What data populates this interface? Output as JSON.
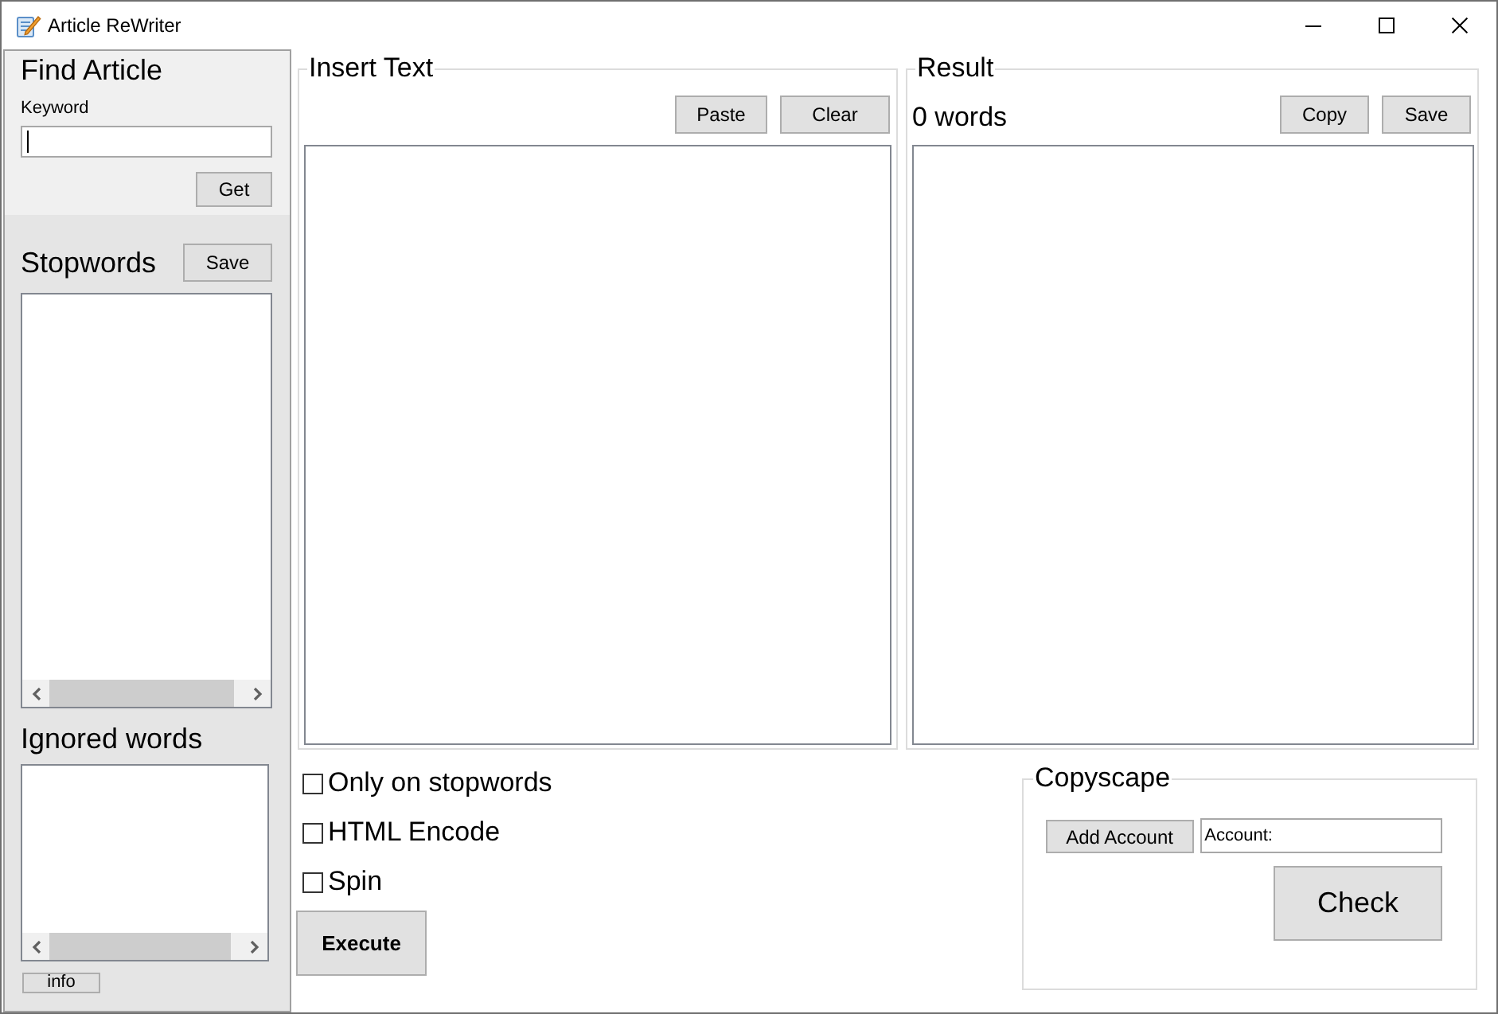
{
  "window": {
    "title": "Article ReWriter"
  },
  "find_article": {
    "title": "Find Article",
    "keyword_label": "Keyword",
    "keyword_field": {
      "focused": true
    },
    "get_button": "Get"
  },
  "stopwords": {
    "title": "Stopwords",
    "save_button": "Save"
  },
  "ignored_words": {
    "title": "Ignored words"
  },
  "info_button": "info",
  "insert_text": {
    "title": "Insert Text",
    "buttons": [
      "Paste",
      "Clear"
    ]
  },
  "result": {
    "title": "Result",
    "word_count": "0 words",
    "buttons": [
      "Copy",
      "Save"
    ]
  },
  "options": [
    {
      "label": "Only on stopwords",
      "checked": false
    },
    {
      "label": "HTML Encode",
      "checked": false
    },
    {
      "label": "Spin",
      "checked": false
    }
  ],
  "execute_button": "Execute",
  "copyscape": {
    "title": "Copyscape",
    "add_account_button": "Add Account",
    "account_field": {
      "value": "Account:"
    },
    "check_button": "Check"
  }
}
